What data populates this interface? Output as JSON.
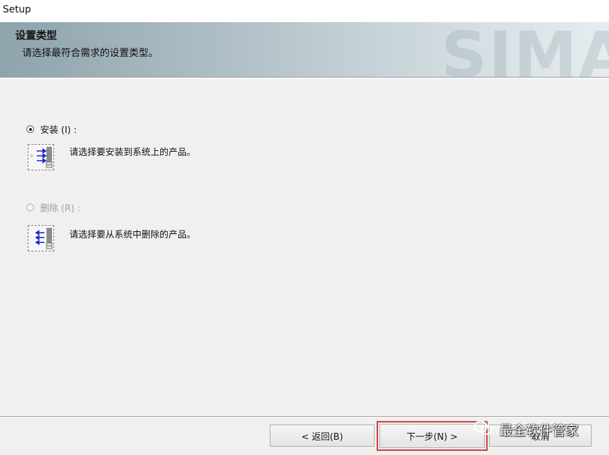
{
  "window": {
    "title": "Setup"
  },
  "banner": {
    "heading": "设置类型",
    "subheading": "请选择最符合需求的设置类型。",
    "watermark": "SIMA"
  },
  "options": [
    {
      "label": "安装 (I) :",
      "description": "请选择要安装到系统上的产品。",
      "checked": true,
      "enabled": true,
      "icon": "install-arrows-icon"
    },
    {
      "label": "删除 (R) :",
      "description": "请选择要从系统中删除的产品。",
      "checked": false,
      "enabled": false,
      "icon": "remove-arrows-icon"
    }
  ],
  "buttons": {
    "back": "< 返回(B)",
    "next": "下一步(N) >",
    "cancel": "取消"
  },
  "overlay": {
    "watermark_text": "最全软件管家"
  },
  "colors": {
    "highlight": "#d23a3a",
    "arrow": "#1f2bd6"
  }
}
